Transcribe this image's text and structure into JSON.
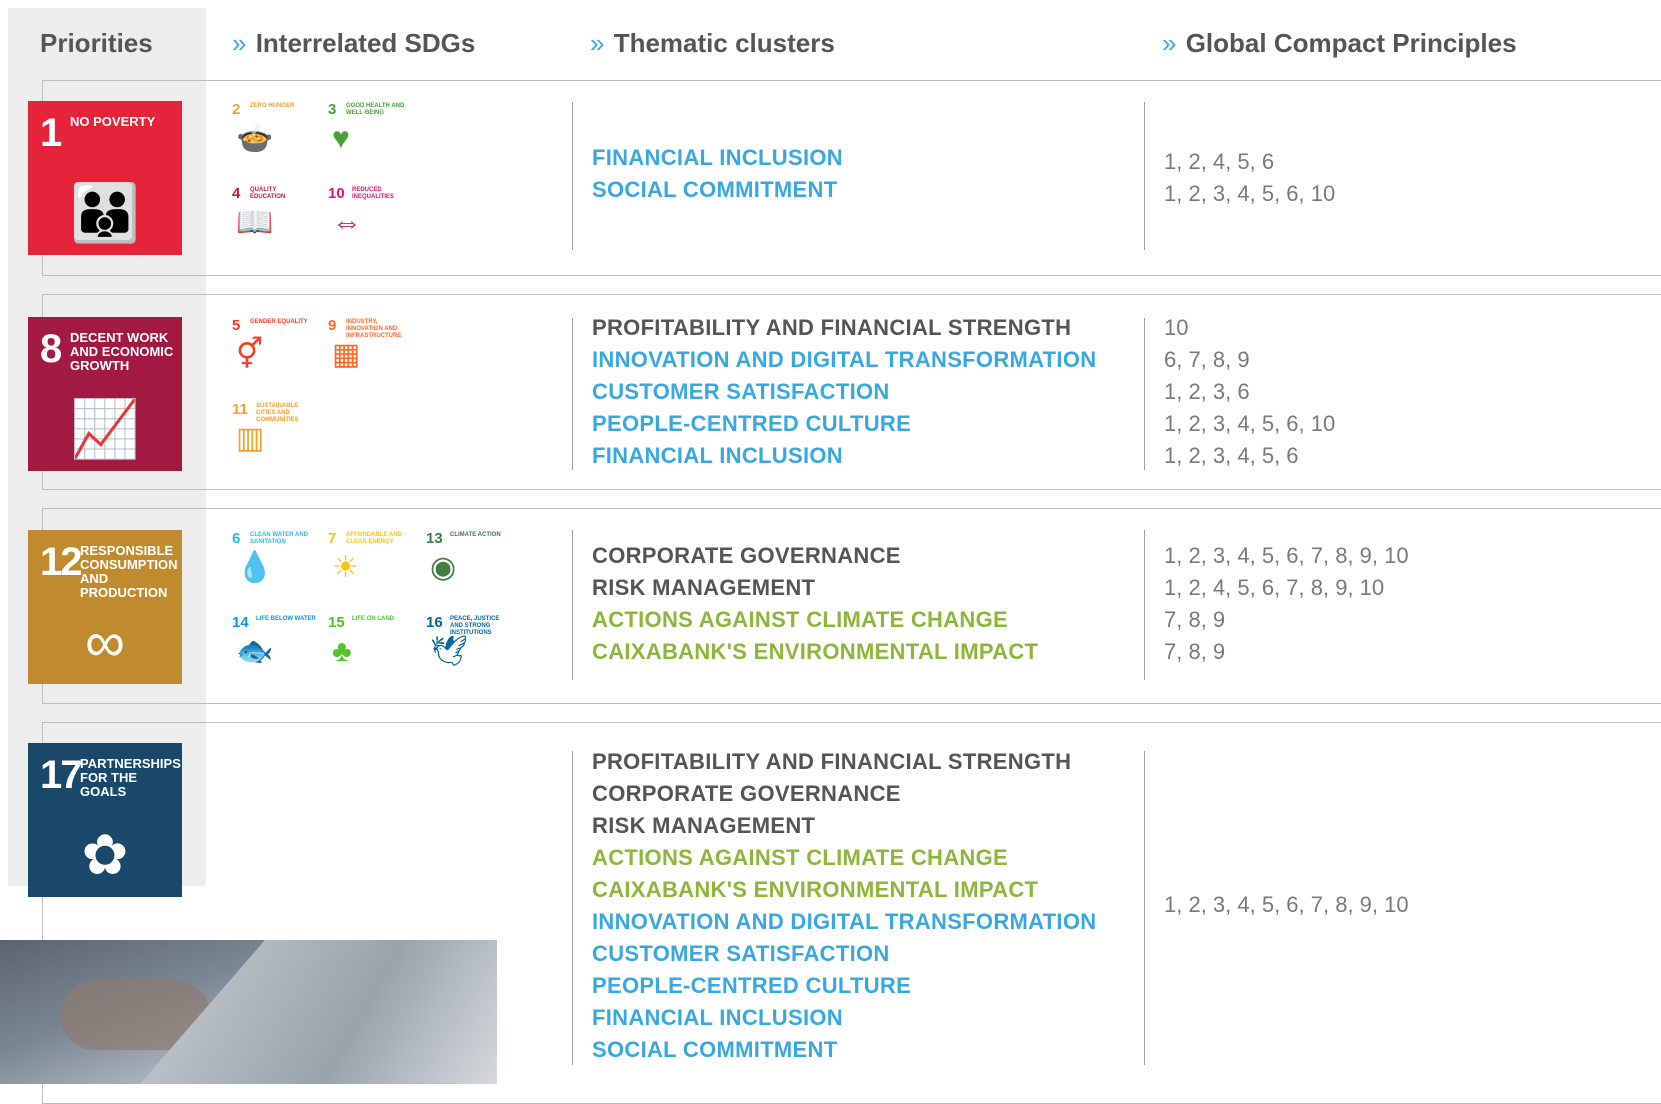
{
  "headers": {
    "priorities": "Priorities",
    "interrelated": "Interrelated SDGs",
    "clusters": "Thematic clusters",
    "principles": "Global Compact Principles",
    "chevron": "»"
  },
  "colors": {
    "blue": "#3aa8e0",
    "green": "#8db63c",
    "dark": "#555555",
    "gray": "#7a7a7a"
  },
  "sections": [
    {
      "sdg": {
        "num": "1",
        "title": "NO POVERTY",
        "color": "#e5243b",
        "icon": "family-icon"
      },
      "related": [
        {
          "num": "2",
          "label": "ZERO HUNGER",
          "color": "#dda63a",
          "icon": "bowl-icon"
        },
        {
          "num": "3",
          "label": "GOOD HEALTH AND WELL-BEING",
          "color": "#4c9f38",
          "icon": "heartbeat-icon"
        },
        {
          "num": "4",
          "label": "QUALITY EDUCATION",
          "color": "#c5192d",
          "icon": "book-icon"
        },
        {
          "num": "10",
          "label": "REDUCED INEQUALITIES",
          "color": "#dd1367",
          "icon": "equality-icon"
        }
      ],
      "clusters": [
        {
          "text": "FINANCIAL INCLUSION",
          "tone": "blue"
        },
        {
          "text": "SOCIAL COMMITMENT",
          "tone": "blue"
        }
      ],
      "principles": [
        "1, 2, 4, 5, 6",
        "1, 2, 3, 4, 5, 6, 10"
      ]
    },
    {
      "sdg": {
        "num": "8",
        "title": "DECENT WORK AND ECONOMIC GROWTH",
        "color": "#a21942",
        "icon": "growth-chart-icon"
      },
      "related": [
        {
          "num": "5",
          "label": "GENDER EQUALITY",
          "color": "#ff3a21",
          "icon": "gender-icon"
        },
        {
          "num": "9",
          "label": "INDUSTRY, INNOVATION AND INFRASTRUCTURE",
          "color": "#fd6925",
          "icon": "cubes-icon"
        },
        {
          "num": "11",
          "label": "SUSTAINABLE CITIES AND COMMUNITIES",
          "color": "#fd9d24",
          "icon": "city-icon"
        }
      ],
      "clusters": [
        {
          "text": "PROFITABILITY AND FINANCIAL STRENGTH",
          "tone": "dark"
        },
        {
          "text": "INNOVATION AND DIGITAL TRANSFORMATION",
          "tone": "blue"
        },
        {
          "text": "CUSTOMER SATISFACTION",
          "tone": "blue"
        },
        {
          "text": "PEOPLE-CENTRED CULTURE",
          "tone": "blue"
        },
        {
          "text": "FINANCIAL INCLUSION",
          "tone": "blue"
        }
      ],
      "principles": [
        "10",
        "6, 7, 8, 9",
        "1, 2, 3, 6",
        "1, 2, 3, 4, 5, 6, 10",
        "1, 2, 3, 4, 5, 6"
      ]
    },
    {
      "sdg": {
        "num": "12",
        "title": "RESPONSIBLE CONSUMPTION AND PRODUCTION",
        "color": "#bf8b2e",
        "icon": "infinity-icon"
      },
      "related": [
        {
          "num": "6",
          "label": "CLEAN WATER AND SANITATION",
          "color": "#26bde2",
          "icon": "water-drop-icon"
        },
        {
          "num": "7",
          "label": "AFFORDABLE AND CLEAN ENERGY",
          "color": "#fcc30b",
          "icon": "sun-icon"
        },
        {
          "num": "13",
          "label": "CLIMATE ACTION",
          "color": "#3f7e44",
          "icon": "eye-globe-icon"
        },
        {
          "num": "14",
          "label": "LIFE BELOW WATER",
          "color": "#0a97d9",
          "icon": "fish-icon"
        },
        {
          "num": "15",
          "label": "LIFE ON LAND",
          "color": "#56c02b",
          "icon": "tree-icon"
        },
        {
          "num": "16",
          "label": "PEACE, JUSTICE AND STRONG INSTITUTIONS",
          "color": "#00689d",
          "icon": "dove-icon"
        }
      ],
      "clusters": [
        {
          "text": "CORPORATE GOVERNANCE",
          "tone": "dark"
        },
        {
          "text": "RISK MANAGEMENT",
          "tone": "dark"
        },
        {
          "text": "ACTIONS AGAINST CLIMATE CHANGE",
          "tone": "green"
        },
        {
          "text": "CAIXABANK'S ENVIRONMENTAL IMPACT",
          "tone": "green"
        }
      ],
      "principles": [
        "1, 2, 3, 4, 5, 6, 7, 8, 9, 10",
        "1, 2, 4, 5, 6, 7, 8, 9, 10",
        "7, 8, 9",
        "7, 8, 9"
      ]
    },
    {
      "sdg": {
        "num": "17",
        "title": "PARTNERSHIPS FOR THE GOALS",
        "color": "#19486a",
        "icon": "rings-icon"
      },
      "related": [],
      "clusters": [
        {
          "text": "PROFITABILITY AND FINANCIAL STRENGTH",
          "tone": "dark"
        },
        {
          "text": "CORPORATE GOVERNANCE",
          "tone": "dark"
        },
        {
          "text": "RISK MANAGEMENT",
          "tone": "dark"
        },
        {
          "text": "ACTIONS AGAINST CLIMATE CHANGE",
          "tone": "green"
        },
        {
          "text": "CAIXABANK'S ENVIRONMENTAL IMPACT",
          "tone": "green"
        },
        {
          "text": "INNOVATION AND DIGITAL TRANSFORMATION",
          "tone": "blue"
        },
        {
          "text": "CUSTOMER SATISFACTION",
          "tone": "blue"
        },
        {
          "text": "PEOPLE-CENTRED CULTURE",
          "tone": "blue"
        },
        {
          "text": "FINANCIAL INCLUSION",
          "tone": "blue"
        },
        {
          "text": "SOCIAL COMMITMENT",
          "tone": "blue"
        }
      ],
      "principles": [
        "1, 2, 3, 4, 5, 6, 7, 8, 9, 10"
      ]
    }
  ]
}
